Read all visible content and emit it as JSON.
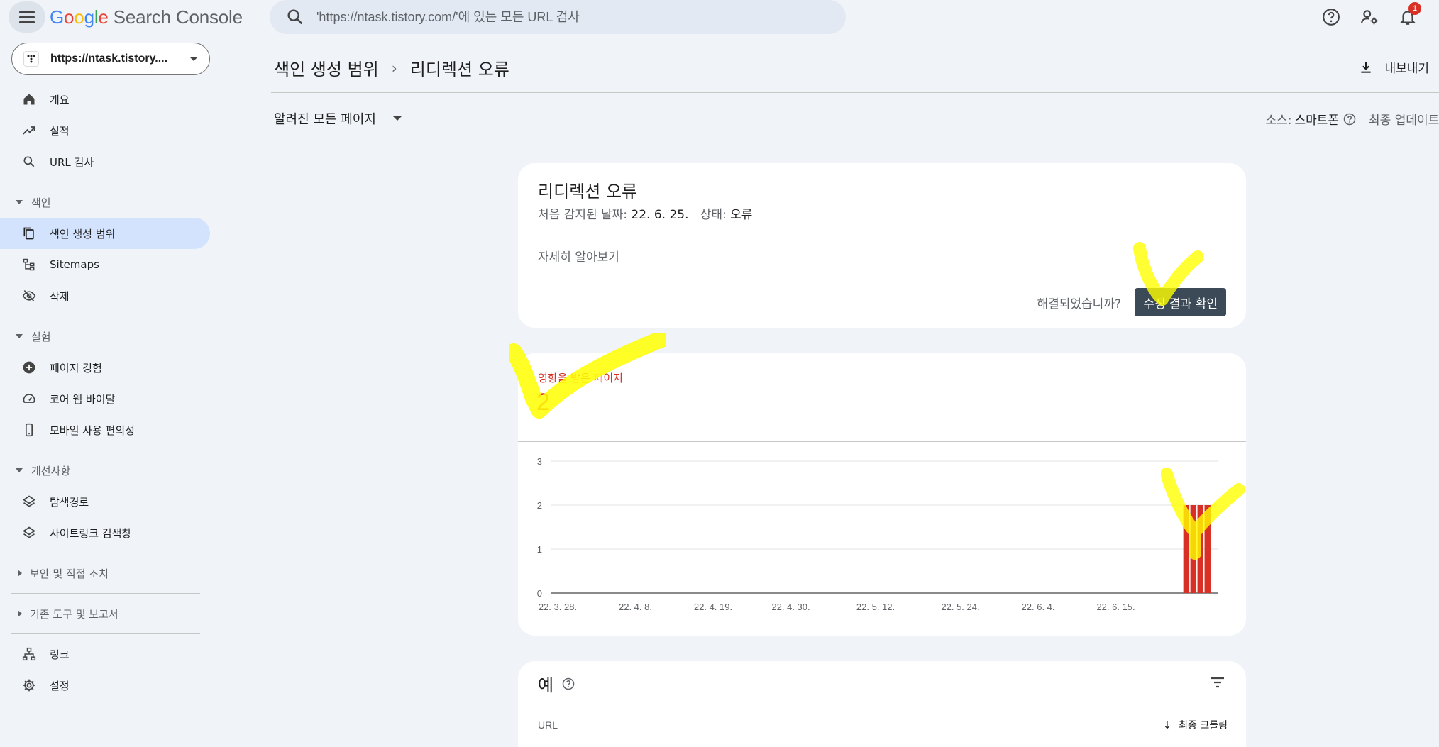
{
  "app": {
    "logo_google": [
      "G",
      "o",
      "o",
      "g",
      "l",
      "e"
    ],
    "logo_product": "Search Console"
  },
  "search": {
    "placeholder": "'https://ntask.tistory.com/'에 있는 모든 URL 검사"
  },
  "notifications": {
    "count": "1"
  },
  "property": {
    "label": "https://ntask.tistory...."
  },
  "sidebar": {
    "items_top": [
      {
        "label": "개요",
        "icon": "home-icon"
      },
      {
        "label": "실적",
        "icon": "trending-up-icon"
      },
      {
        "label": "URL 검사",
        "icon": "search-icon"
      }
    ],
    "group_index": "색인",
    "items_index": [
      {
        "label": "색인 생성 범위",
        "icon": "file-copy-icon",
        "active": true
      },
      {
        "label": "Sitemaps",
        "icon": "sitemap-icon"
      },
      {
        "label": "삭제",
        "icon": "visibility-off-icon"
      }
    ],
    "group_experience": "실험",
    "items_experience": [
      {
        "label": "페이지 경험",
        "icon": "add-circle-icon"
      },
      {
        "label": "코어 웹 바이탈",
        "icon": "speed-gauge-icon"
      },
      {
        "label": "모바일 사용 편의성",
        "icon": "smartphone-icon"
      }
    ],
    "group_enhancements": "개선사항",
    "items_enhancements": [
      {
        "label": "탐색경로",
        "icon": "layers-icon"
      },
      {
        "label": "사이트링크 검색창",
        "icon": "layers-icon"
      }
    ],
    "group_security": "보안 및 직접 조치",
    "group_legacy": "기존 도구 및 보고서",
    "items_bottom": [
      {
        "label": "링크",
        "icon": "links-icon"
      },
      {
        "label": "설정",
        "icon": "settings-icon"
      }
    ]
  },
  "header": {
    "breadcrumb_parent": "색인 생성 범위",
    "breadcrumb_current": "리디렉션 오류",
    "export_label": "내보내기",
    "filter_label": "알려진 모든 페이지",
    "source_label": "소스:",
    "source_value": "스마트폰",
    "last_update_label": "최종 업데이트:"
  },
  "issue_card": {
    "title": "리디렉션 오류",
    "first_detected_label": "처음 감지된 날짜:",
    "first_detected_value": "22. 6. 25.",
    "status_label": "상태:",
    "status_value": "오류",
    "learn_more": "자세히 알아보기",
    "resolved_question": "해결되었습니까?",
    "validate_button": "수정 결과 확인"
  },
  "chart_card": {
    "metric_label": "영향을 받은 페이지",
    "metric_value": "2"
  },
  "chart_data": {
    "type": "bar",
    "ylim": [
      0,
      3
    ],
    "y_ticks": [
      "0",
      "1",
      "2",
      "3"
    ],
    "x_tick_labels": [
      "22. 3. 28.",
      "22. 4. 8.",
      "22. 4. 19.",
      "22. 4. 30.",
      "22. 5. 12.",
      "22. 5. 24.",
      "22. 6. 4.",
      "22. 6. 15."
    ],
    "x_range": [
      "22. 3. 27.",
      "22. 6. 28."
    ],
    "bars": [
      {
        "date": "22. 6. 25.",
        "value": 2
      },
      {
        "date": "22. 6. 26.",
        "value": 2
      },
      {
        "date": "22. 6. 27.",
        "value": 2
      },
      {
        "date": "22. 6. 28.",
        "value": 2
      }
    ],
    "bar_color": "#d93025",
    "grid": true
  },
  "examples_card": {
    "title": "예",
    "col_url": "URL",
    "col_last_crawl": "최종 크롤링"
  },
  "colors": {
    "accent": "#d3e3fd",
    "error": "#d93025",
    "highlight": "#ffff00"
  }
}
